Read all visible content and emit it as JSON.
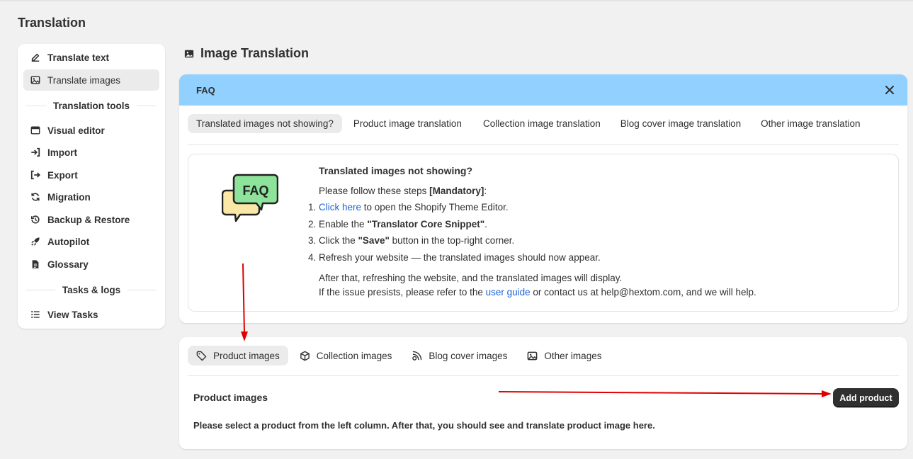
{
  "page": {
    "title": "Translation"
  },
  "sidebar": {
    "items": [
      {
        "label": "Translate text",
        "icon": "edit-icon"
      },
      {
        "label": "Translate images",
        "icon": "image-icon",
        "active": true
      }
    ],
    "tools_heading": "Translation tools",
    "tools": [
      {
        "label": "Visual editor",
        "icon": "browser-window-icon"
      },
      {
        "label": "Import",
        "icon": "import-icon"
      },
      {
        "label": "Export",
        "icon": "export-icon"
      },
      {
        "label": "Migration",
        "icon": "sync-icon"
      },
      {
        "label": "Backup & Restore",
        "icon": "history-icon"
      },
      {
        "label": "Autopilot",
        "icon": "rocket-icon"
      },
      {
        "label": "Glossary",
        "icon": "document-icon"
      }
    ],
    "logs_heading": "Tasks & logs",
    "logs": [
      {
        "label": "View Tasks",
        "icon": "list-icon"
      }
    ]
  },
  "main": {
    "title": "Image Translation",
    "faq": {
      "header": "FAQ",
      "header_color": "#91d0ff",
      "tabs": [
        "Translated images not showing?",
        "Product image translation",
        "Collection image translation",
        "Blog cover image translation",
        "Other image translation"
      ],
      "illustration_text": "FAQ",
      "question": "Translated images not showing?",
      "intro": "Please follow these steps ",
      "intro_bold": "[Mandatory]",
      "intro_end": ":",
      "step1_link": "Click here",
      "step1_rest": " to open the Shopify Theme Editor.",
      "step2_pre": "Enable the ",
      "step2_bold": "\"Translator Core Snippet\"",
      "step2_post": ".",
      "step3_pre": "Click the ",
      "step3_bold": "\"Save\"",
      "step3_post": " button in the top-right corner.",
      "step4": "Refresh your website — the translated images should now appear.",
      "after1": "After that, refreshing the website, and the translated images will display.",
      "after2_pre": "If the issue presists, please refer to the ",
      "after2_link": "user guide",
      "after2_post": " or contact us at help@hextom.com, and we will help."
    },
    "images": {
      "tabs": [
        {
          "label": "Product images",
          "icon": "tag-icon"
        },
        {
          "label": "Collection images",
          "icon": "box-icon"
        },
        {
          "label": "Blog cover images",
          "icon": "blog-icon"
        },
        {
          "label": "Other images",
          "icon": "image-icon"
        }
      ],
      "subtitle": "Product images",
      "add_button": "Add product",
      "hint": "Please select a product from the left column. After that, you should see and translate product image here."
    }
  },
  "colors": {
    "accent_link": "#1e62d6",
    "annotation_arrow": "#e00000",
    "button_dark": "#303030"
  }
}
